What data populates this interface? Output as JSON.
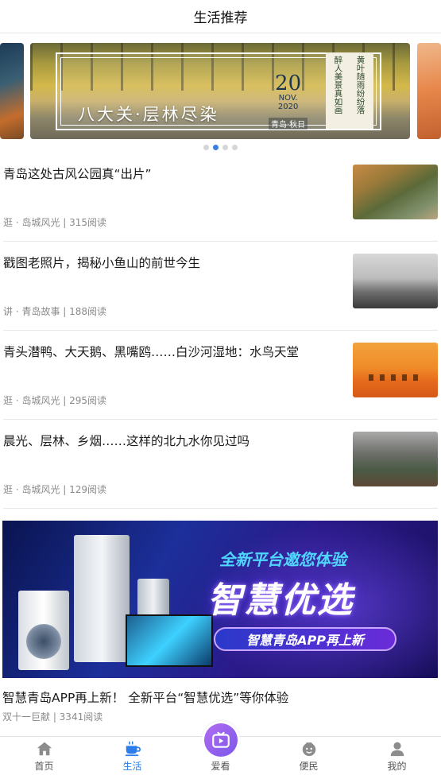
{
  "header": {
    "title": "生活推荐"
  },
  "carousel": {
    "caption": "八大关·层林尽染",
    "date_day": "20",
    "date_month": "NOV.",
    "date_year": "2020",
    "location": "青岛·秋日",
    "poem": [
      "黄叶随雨纷纷落",
      "醉人美景真如画"
    ],
    "dots": 4,
    "active_dot": 1
  },
  "articles": [
    {
      "title": "青岛这处古风公园真“出片”",
      "meta": "逛 · 岛城风光 | 315阅读",
      "thumb": "park-photo"
    },
    {
      "title": "戳图老照片，揭秘小鱼山的前世今生",
      "meta": "讲 · 青岛故事 | 188阅读",
      "thumb": "old-photo"
    },
    {
      "title": "青头潜鸭、大天鹅、黑嘴鸥……白沙河湿地：水鸟天堂",
      "meta": "逛 · 岛城风光 | 295阅读",
      "thumb": "wetland-photo"
    },
    {
      "title": "晨光、层林、乡烟……这样的北九水你见过吗",
      "meta": "逛 · 岛城风光 | 129阅读",
      "thumb": "mountain-photo"
    }
  ],
  "promo": {
    "tag": "全新平台邀您体验",
    "headline": "智慧优选",
    "pill": "智慧青岛APP再上新",
    "caption": "智慧青岛APP再上新！ 全新平台“智慧优选”等你体验",
    "meta": "双十一巨献 | 3341阅读"
  },
  "tabbar": {
    "items": [
      {
        "label": "首页",
        "icon": "home-icon"
      },
      {
        "label": "生活",
        "icon": "coffee-cup-icon"
      },
      {
        "label": "爱看",
        "icon": "tv-icon"
      },
      {
        "label": "便民",
        "icon": "smile-face-icon"
      },
      {
        "label": "我的",
        "icon": "user-icon"
      }
    ],
    "active_index": 1,
    "colors": {
      "active": "#2b7de9",
      "inactive": "#8c8c8c",
      "center": "#9b63ee"
    }
  }
}
